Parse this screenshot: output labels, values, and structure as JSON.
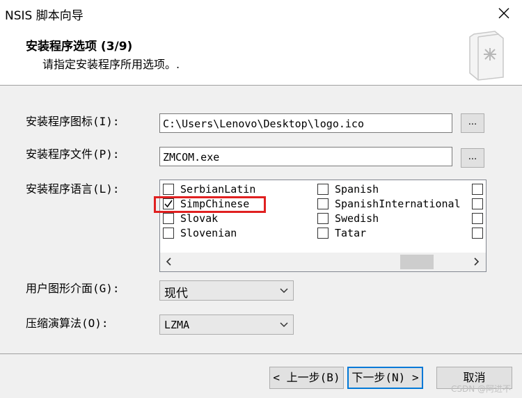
{
  "window": {
    "title": "NSIS 脚本向导"
  },
  "header": {
    "title": "安装程序选项 (3/9)",
    "subtitle": "请指定安装程序所用选项。."
  },
  "fields": {
    "icon_label": "安装程序图标(I):",
    "icon_value": "C:\\Users\\Lenovo\\Desktop\\logo.ico",
    "file_label": "安装程序文件(P):",
    "file_value": "ZMCOM.exe",
    "browse_label": "...",
    "lang_label": "安装程序语言(L):",
    "ui_label": "用户图形介面(G):",
    "ui_value": "现代",
    "compress_label": "压缩演算法(O):",
    "compress_value": "LZMA"
  },
  "languages": {
    "col1": [
      {
        "name": "SerbianLatin",
        "checked": false
      },
      {
        "name": "SimpChinese",
        "checked": true
      },
      {
        "name": "Slovak",
        "checked": false
      },
      {
        "name": "Slovenian",
        "checked": false
      }
    ],
    "col2": [
      {
        "name": "Spanish",
        "checked": false
      },
      {
        "name": "SpanishInternational",
        "checked": false
      },
      {
        "name": "Swedish",
        "checked": false
      },
      {
        "name": "Tatar",
        "checked": false
      }
    ]
  },
  "buttons": {
    "back": "< 上一步(B)",
    "next": "下一步(N) >",
    "cancel": "取消"
  },
  "watermark": "CSDN @阿进不"
}
